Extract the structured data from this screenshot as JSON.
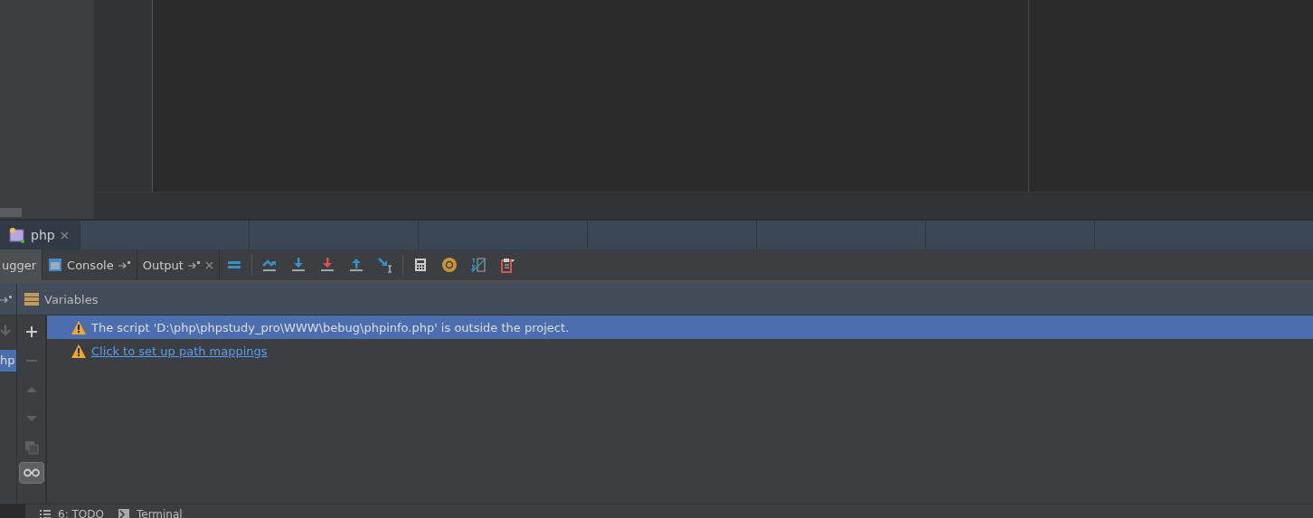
{
  "tool_window_tabs": [
    {
      "label": "php",
      "selected": true
    }
  ],
  "debugger_tabs": [
    {
      "label": "ugger",
      "selected": true,
      "kind": "plain"
    },
    {
      "label": "Console",
      "selected": false,
      "kind": "console"
    },
    {
      "label": "Output",
      "selected": false,
      "kind": "output"
    }
  ],
  "variables": {
    "title": "Variables",
    "frames": [
      {
        "label": "hp",
        "selected": true
      }
    ],
    "messages": [
      {
        "kind": "text",
        "text": "The script 'D:\\php\\phpstudy_pro\\WWW\\bebug\\phpinfo.php' is outside the project.",
        "selected": true
      },
      {
        "kind": "link",
        "text": "Click to set up path mappings",
        "selected": false
      }
    ],
    "watches_toggle": {
      "on": true
    }
  },
  "status_bar": [
    {
      "label": "6: TODO",
      "kind": "todo"
    },
    {
      "label": "Terminal",
      "kind": "terminal"
    }
  ]
}
